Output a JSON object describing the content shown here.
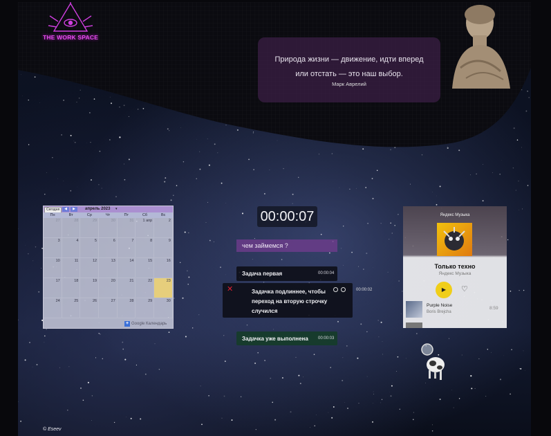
{
  "logo": {
    "text": "THE WORK SPACE",
    "icon": "eye-triangle-icon"
  },
  "quote": {
    "text": "Природа жизни — движение, идти вперед или отстать — это наш выбор.",
    "author": "Марк Аврелий"
  },
  "calendar": {
    "today_label": "Сегодня",
    "prev_icon": "◀",
    "next_icon": "▶",
    "month": "апрель 2023",
    "month_arrow": "▾",
    "weekdays": [
      "Пн",
      "Вт",
      "Ср",
      "Чт",
      "Пт",
      "Сб",
      "Вс"
    ],
    "weeks": [
      [
        [
          "27",
          true
        ],
        [
          "28",
          true
        ],
        [
          "29",
          true
        ],
        [
          "30",
          true
        ],
        [
          "31",
          true
        ],
        [
          "1 апр",
          false
        ],
        [
          "2",
          false
        ]
      ],
      [
        [
          "3",
          false
        ],
        [
          "4",
          false
        ],
        [
          "5",
          false
        ],
        [
          "6",
          false
        ],
        [
          "7",
          false
        ],
        [
          "8",
          false
        ],
        [
          "9",
          false
        ]
      ],
      [
        [
          "10",
          false
        ],
        [
          "11",
          false
        ],
        [
          "12",
          false
        ],
        [
          "13",
          false
        ],
        [
          "14",
          false
        ],
        [
          "15",
          false
        ],
        [
          "16",
          false
        ]
      ],
      [
        [
          "17",
          false
        ],
        [
          "18",
          false
        ],
        [
          "19",
          false
        ],
        [
          "20",
          false
        ],
        [
          "21",
          false
        ],
        [
          "22",
          false
        ],
        [
          "23",
          false
        ]
      ],
      [
        [
          "24",
          false
        ],
        [
          "25",
          false
        ],
        [
          "26",
          false
        ],
        [
          "27",
          false
        ],
        [
          "28",
          false
        ],
        [
          "29",
          false
        ],
        [
          "30",
          false
        ]
      ]
    ],
    "today_date": "23",
    "add_icon": "+",
    "brand": "Google Календарь"
  },
  "timer": {
    "value": "00:00:07"
  },
  "task_input": {
    "placeholder": "чем займемся ?"
  },
  "tasks": [
    {
      "label": "Задача первая",
      "time": "00:00:04",
      "status": "active"
    },
    {
      "label": "Задачка подлиннее, чтобы переход на вторую строчку случился",
      "time": "00:00:02",
      "status": "editing"
    },
    {
      "label": "Задачка уже выполнена",
      "time": "00:00:03",
      "status": "done"
    }
  ],
  "music": {
    "brand": "Яндекс Музыка",
    "album_title": "Только техно",
    "album_artist": "Яндекс Музыка",
    "play_icon": "▶",
    "like_icon": "♡",
    "tracks": [
      {
        "title": "Purple Noise",
        "artist": "Boris Brejcha",
        "duration": "8:59"
      }
    ]
  },
  "footer": {
    "copyright": "© Eseev"
  },
  "colors": {
    "accent_purple": "#7a3e98",
    "logo_magenta": "#e04ce8",
    "play_yellow": "#f0ce19",
    "done_green": "#143c28"
  }
}
